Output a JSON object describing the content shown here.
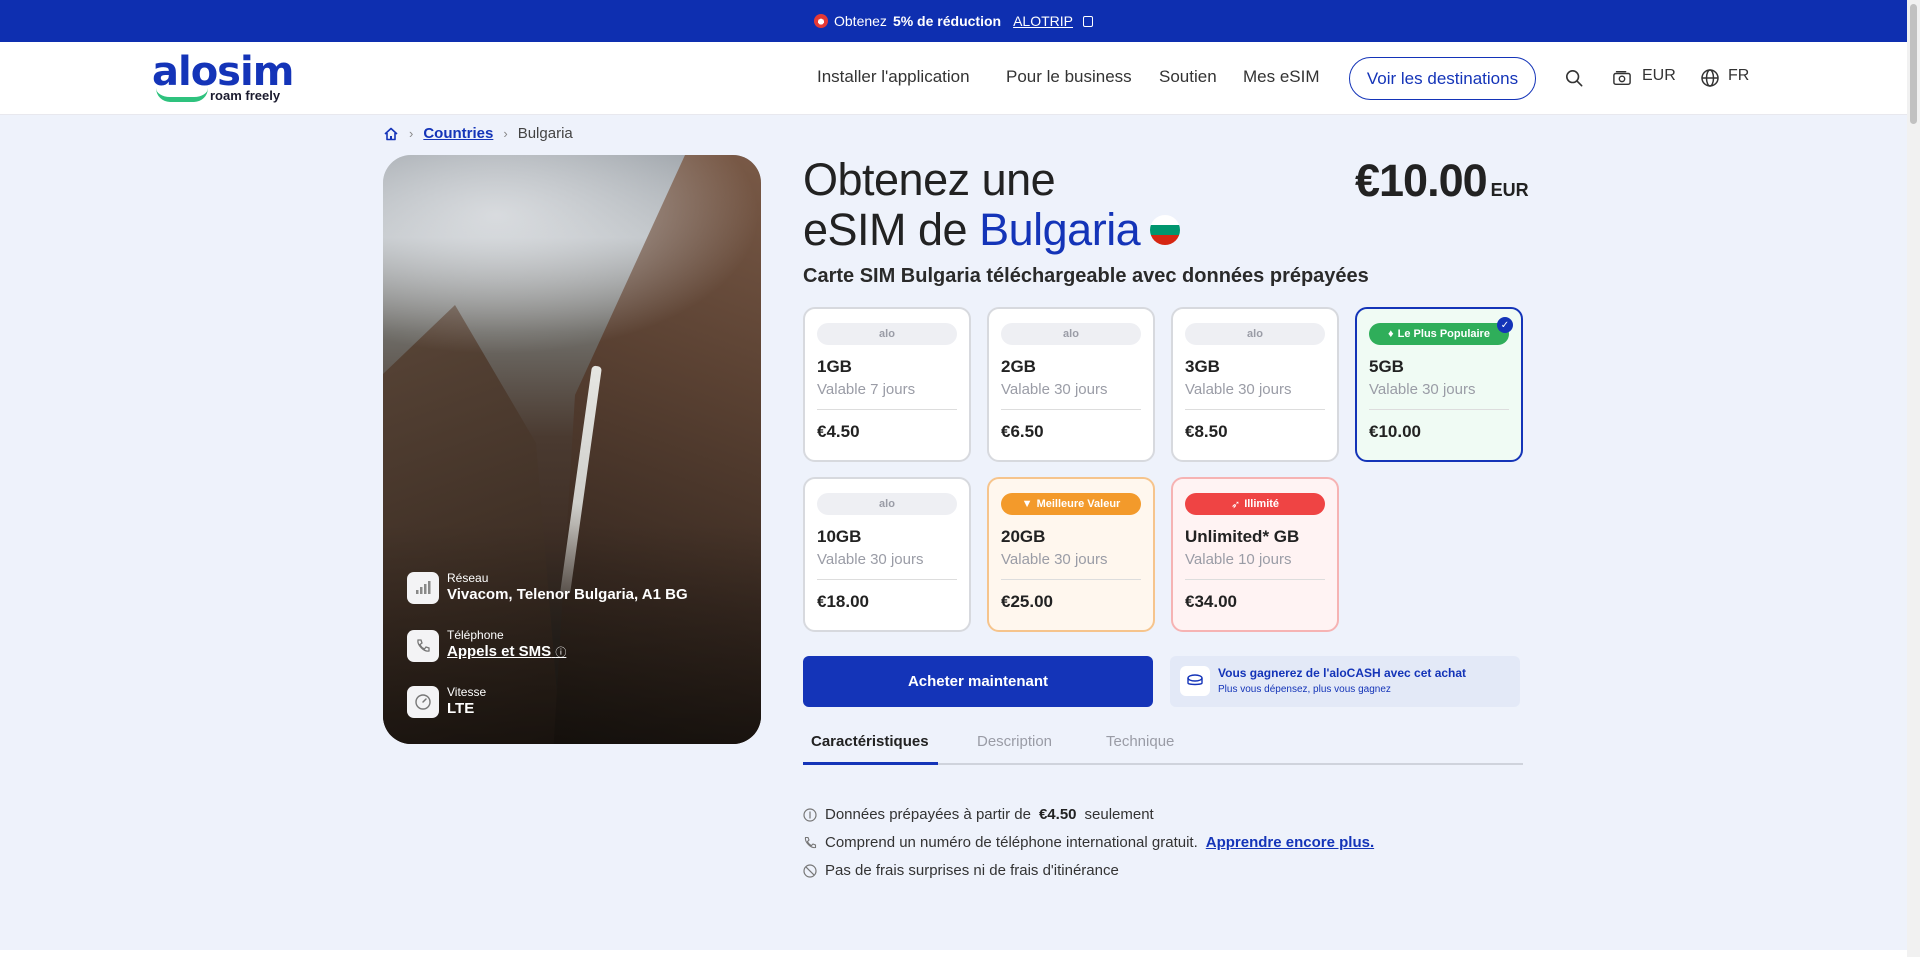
{
  "promo": {
    "prefix": "Obtenez",
    "discount": "5% de réduction",
    "code": "ALOTRIP"
  },
  "header": {
    "logo_word": "alosim",
    "logo_tagline": "roam freely",
    "nav": [
      "Installer l'application",
      "Pour le business",
      "Soutien",
      "Mes eSIM"
    ],
    "destinations_button": "Voir les destinations",
    "currency": "EUR",
    "language": "FR"
  },
  "breadcrumb": {
    "link": "Countries",
    "current": "Bulgaria"
  },
  "hero": {
    "specs": [
      {
        "label": "Réseau",
        "value": "Vivacom, Telenor Bulgaria, A1 BG",
        "icon": "signal-icon"
      },
      {
        "label": "Téléphone",
        "value": "Appels et SMS",
        "icon": "phone-icon"
      },
      {
        "label": "Vitesse",
        "value": "LTE",
        "icon": "speedometer-icon"
      }
    ]
  },
  "product": {
    "title_line1": "Obtenez une",
    "title_line2_prefix": "eSIM de",
    "country": "Bulgaria",
    "price": "€10.00",
    "price_currency": "EUR",
    "subtitle": "Carte SIM Bulgaria téléchargeable avec données prépayées"
  },
  "plans": [
    {
      "badge": "alo",
      "gb": "1GB",
      "validity": "Valable 7 jours",
      "price": "€4.50",
      "style": "default"
    },
    {
      "badge": "alo",
      "gb": "2GB",
      "validity": "Valable 30 jours",
      "price": "€6.50",
      "style": "default"
    },
    {
      "badge": "alo",
      "gb": "3GB",
      "validity": "Valable 30 jours",
      "price": "€8.50",
      "style": "default"
    },
    {
      "badge": "Le Plus Populaire",
      "gb": "5GB",
      "validity": "Valable 30 jours",
      "price": "€10.00",
      "style": "selected"
    },
    {
      "badge": "alo",
      "gb": "10GB",
      "validity": "Valable 30 jours",
      "price": "€18.00",
      "style": "default"
    },
    {
      "badge": "Meilleure Valeur",
      "gb": "20GB",
      "validity": "Valable 30 jours",
      "price": "€25.00",
      "style": "best"
    },
    {
      "badge": "Illimité",
      "gb": "Unlimited* GB",
      "validity": "Valable 10 jours",
      "price": "€34.00",
      "style": "unlimited"
    }
  ],
  "buy_button": "Acheter maintenant",
  "alocash": {
    "title": "Vous gagnerez de l'aloCASH avec cet achat",
    "subtitle": "Plus vous dépensez, plus vous gagnez"
  },
  "tabs": [
    "Caractéristiques",
    "Description",
    "Technique"
  ],
  "features": [
    {
      "text_before": "Données prépayées à partir de",
      "bold": "€4.50",
      "text_after": "seulement"
    },
    {
      "text_before": "Comprend un numéro de téléphone international gratuit.",
      "link": "Apprendre encore plus."
    },
    {
      "text_before": "Pas de frais surprises ni de frais d'itinérance"
    }
  ],
  "colors": {
    "brand_blue": "#1434b8",
    "accent_green": "#2fae5a",
    "accent_orange": "#f39a2b",
    "accent_red": "#ef4444"
  }
}
